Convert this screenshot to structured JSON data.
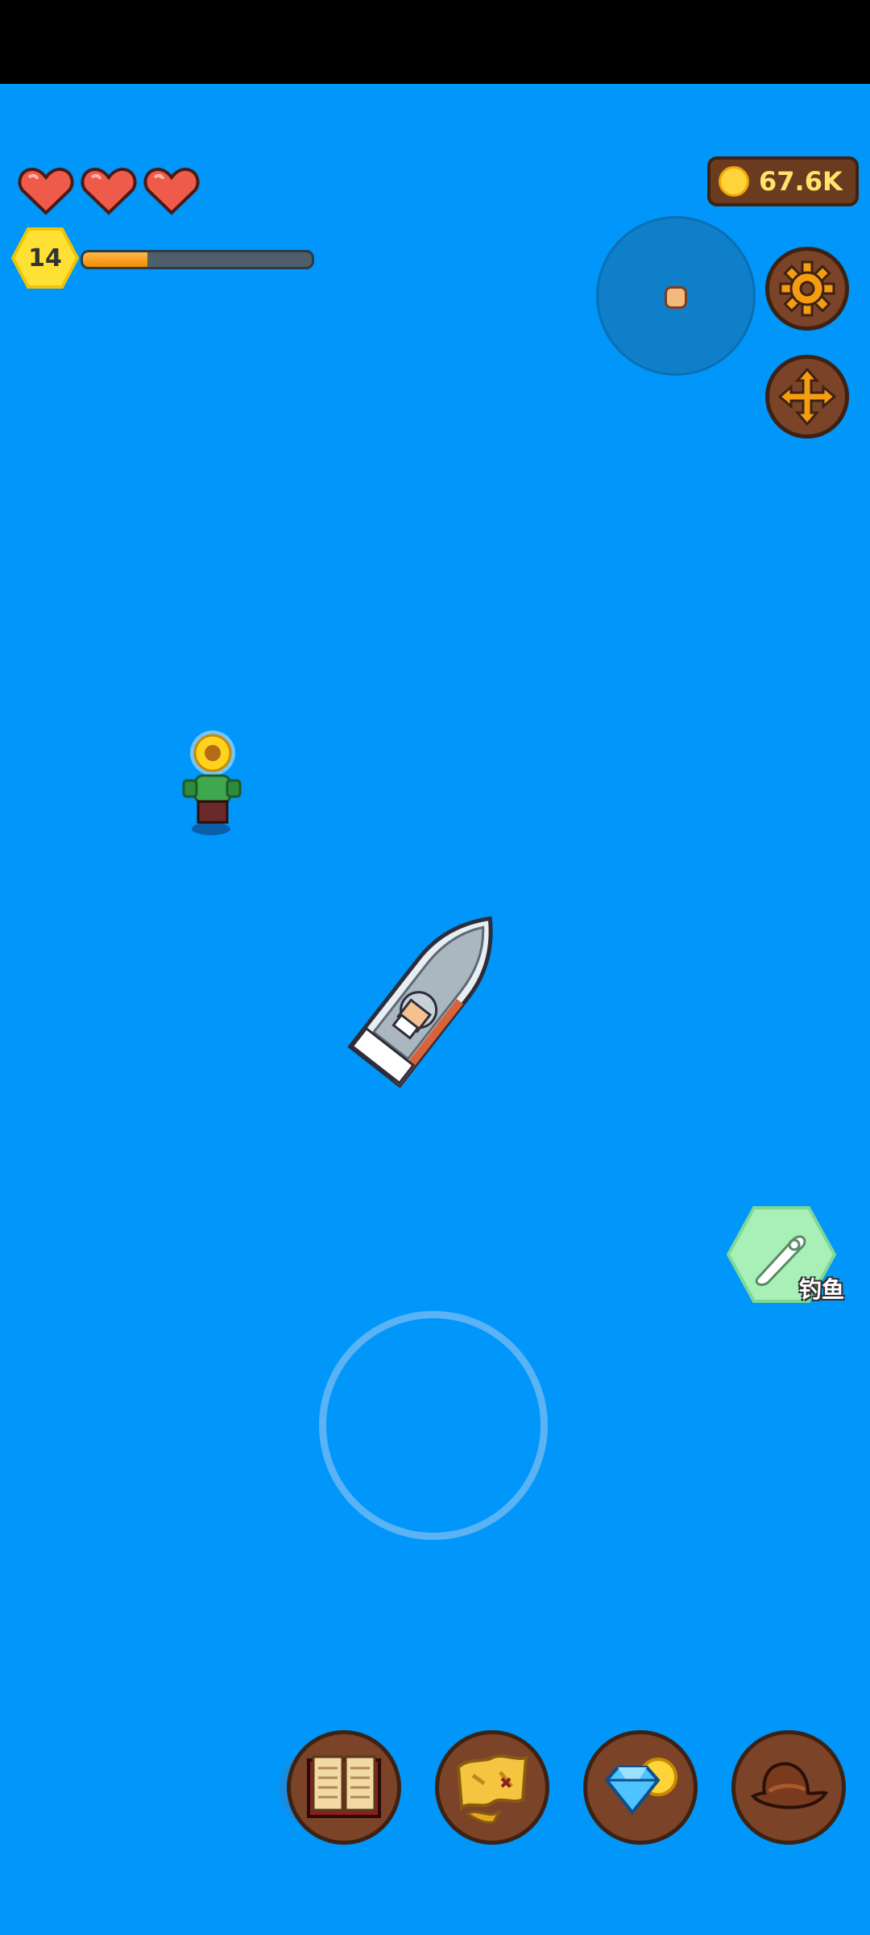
{
  "hud": {
    "hearts": 3,
    "level": "14",
    "xp_progress": 0.28,
    "coins": "67.6K"
  },
  "actions": {
    "fishing_label": "钓鱼"
  },
  "colors": {
    "water": "#0096fa",
    "heart": "#ef5b4a",
    "level_badge": "#ffe135",
    "xp_fill": "#f5a020",
    "coin_text": "#ffe46b",
    "button_wood": "#7b4328",
    "fishing_button": "#a9f0b8"
  },
  "icons": [
    "heart-icon",
    "coin-icon",
    "settings-gear-icon",
    "move-arrows-icon",
    "fishing-rod-icon",
    "book-icon",
    "treasure-map-icon",
    "gem-shop-icon",
    "hat-icon"
  ]
}
